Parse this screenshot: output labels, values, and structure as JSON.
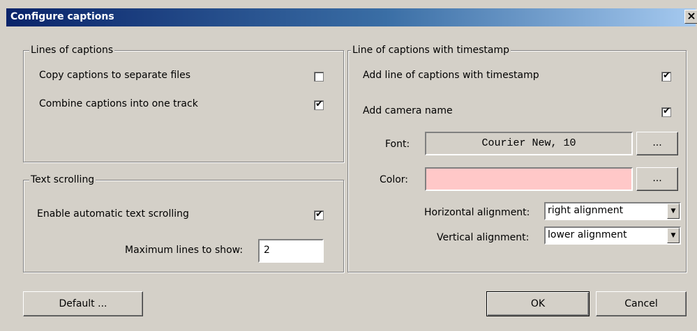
{
  "dialog": {
    "title": "Configure captions",
    "close_label": "×"
  },
  "lines_group": {
    "legend": "Lines of captions",
    "copy_label": "Copy captions to separate files",
    "copy_checked": false,
    "combine_label": "Combine captions into one track",
    "combine_checked": true
  },
  "scroll_group": {
    "legend": "Text scrolling",
    "enable_label": "Enable automatic text scrolling",
    "enable_checked": true,
    "max_lines_label": "Maximum lines to show:",
    "max_lines_value": "2"
  },
  "timestamp_group": {
    "legend": "Line of captions with timestamp",
    "add_line_label": "Add line of captions with timestamp",
    "add_line_checked": true,
    "camera_label": "Add camera name",
    "camera_checked": true,
    "font_label": "Font:",
    "font_value": "Courier New, 10",
    "font_browse": "...",
    "color_label": "Color:",
    "color_value": "#ffc8c8",
    "color_browse": "...",
    "halign_label": "Horizontal alignment:",
    "halign_value": "right alignment",
    "valign_label": "Vertical alignment:",
    "valign_value": "lower alignment"
  },
  "buttons": {
    "default": "Default ...",
    "ok": "OK",
    "cancel": "Cancel"
  },
  "check_glyph": "✔",
  "arrow_glyph": "▼"
}
